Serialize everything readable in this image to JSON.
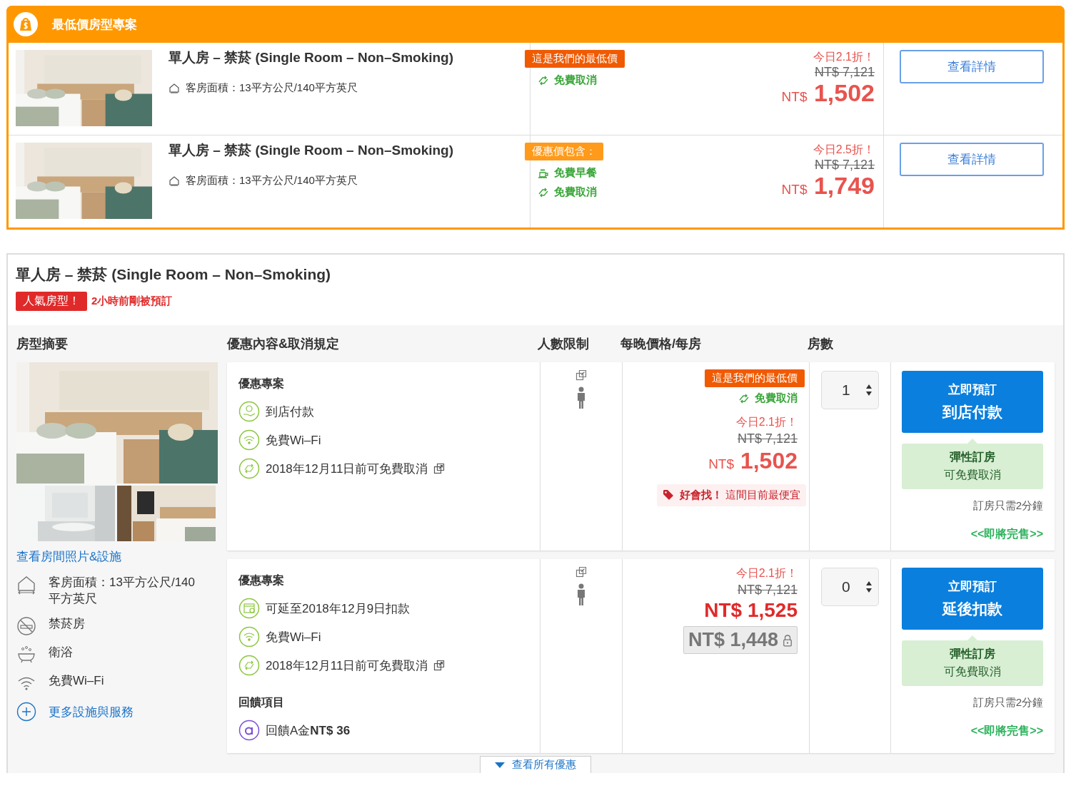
{
  "lowest_price_section": {
    "title": "最低價房型專案",
    "rooms": [
      {
        "name": "單人房 – 禁菸 (Single Room – Non–Smoking)",
        "area": "客房面積：13平方公尺/140平方英尺",
        "badge": {
          "kind": "lowest",
          "text": "這是我們的最低價"
        },
        "perks": [
          {
            "kind": "cancel",
            "text": "免費取消"
          }
        ],
        "discount": "今日2.1折！",
        "original_price": "NT$ 7,121",
        "currency": "NT$",
        "price": "1,502",
        "button": "查看詳情"
      },
      {
        "name": "單人房 – 禁菸 (Single Room – Non–Smoking)",
        "area": "客房面積：13平方公尺/140平方英尺",
        "badge": {
          "kind": "includes",
          "text": "優惠價包含："
        },
        "perks": [
          {
            "kind": "breakfast",
            "text": "免費早餐"
          },
          {
            "kind": "cancel",
            "text": "免費取消"
          }
        ],
        "discount": "今日2.5折！",
        "original_price": "NT$ 7,121",
        "currency": "NT$",
        "price": "1,749",
        "button": "查看詳情"
      }
    ]
  },
  "room": {
    "title": "單人房 – 禁菸 (Single Room – Non–Smoking)",
    "popular_tag": "人氣房型！",
    "recent_booking": "2小時前剛被預訂",
    "columns": [
      "房型摘要",
      "優惠內容&取消規定",
      "人數限制",
      "每晚價格/每房",
      "房數"
    ],
    "photos_link": "查看房間照片&設施",
    "facilities": [
      {
        "kind": "area",
        "text": "客房面積：13平方公尺/140平方英尺"
      },
      {
        "kind": "nosmoking",
        "text": "禁菸房"
      },
      {
        "kind": "bath",
        "text": "衛浴"
      },
      {
        "kind": "wifi",
        "text": "免費Wi–Fi"
      }
    ],
    "more_link": "更多設施與服務",
    "plans": [
      {
        "title": "優惠專案",
        "features": [
          {
            "kind": "pay",
            "text": "到店付款"
          },
          {
            "kind": "wifi",
            "text": "免費Wi–Fi"
          },
          {
            "kind": "cancel",
            "text": "2018年12月11日前可免費取消",
            "link": true
          }
        ],
        "badge": "這是我們的最低價",
        "free_cancel": "免費取消",
        "discount": "今日2.1折！",
        "original_price": "NT$ 7,121",
        "kind": "light",
        "currency": "NT$",
        "price": "1,502",
        "deal": "**好會找！** 這間目前最便宜",
        "quantity": "1",
        "book_button": [
          "立即預訂",
          "到店付款"
        ],
        "flex": {
          "title": "彈性訂房",
          "text": "可免費取消"
        },
        "booking_time": "訂房只需2分鐘",
        "selling_out": "<<即將完售>>"
      },
      {
        "title": "優惠專案",
        "features": [
          {
            "kind": "calendar",
            "text": "可延至2018年12月9日扣款"
          },
          {
            "kind": "wifi",
            "text": "免費Wi–Fi"
          },
          {
            "kind": "cancel",
            "text": "2018年12月11日前可免費取消",
            "link": true
          }
        ],
        "reward": {
          "title": "回饋項目",
          "text": "回饋A金**NT$ 36**"
        },
        "discount": "今日2.1折！",
        "original_price": "NT$ 7,121",
        "kind": "bold",
        "currency": "NT$",
        "price": "1,525",
        "member_price": "NT$ 1,448",
        "quantity": "0",
        "book_button": [
          "立即預訂",
          "延後扣款"
        ],
        "flex": {
          "title": "彈性訂房",
          "text": "可免費取消"
        },
        "booking_time": "訂房只需2分鐘",
        "selling_out": "<<即將完售>>"
      }
    ],
    "show_all": "查看所有優惠"
  }
}
